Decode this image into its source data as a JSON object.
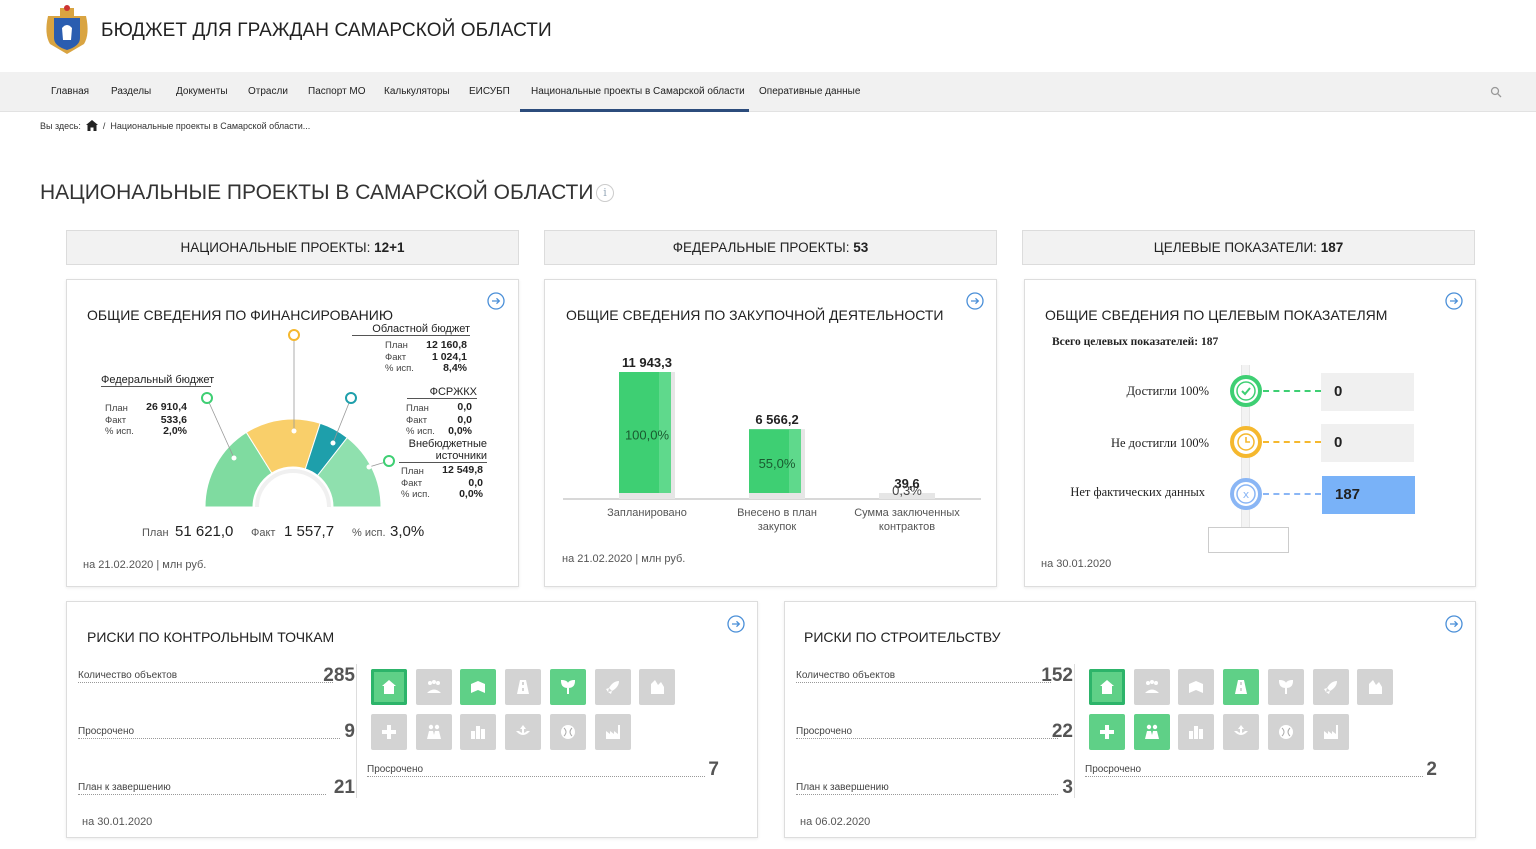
{
  "header": {
    "title": "БЮДЖЕТ ДЛЯ ГРАЖДАН САМАРСКОЙ ОБЛАСТИ"
  },
  "nav": {
    "items": [
      "Главная",
      "Разделы",
      "Документы",
      "Отрасли",
      "Паспорт МО",
      "Калькуляторы",
      "ЕИСУБП",
      "Национальные проекты в Самарской области",
      "Оперативные данные"
    ],
    "active": "Национальные проекты в Самарской области"
  },
  "breadcrumb": {
    "prefix": "Вы здесь:",
    "current": "Национальные проекты в Самарской области..."
  },
  "page": {
    "title": "НАЦИОНАЛЬНЫЕ ПРОЕКТЫ В САМАРСКОЙ ОБЛАСТИ",
    "info": "i"
  },
  "stats": [
    {
      "label": "НАЦИОНАЛЬНЫЕ ПРОЕКТЫ:",
      "value": "12+1"
    },
    {
      "label": "ФЕДЕРАЛЬНЫЕ ПРОЕКТЫ:",
      "value": "53"
    },
    {
      "label": "ЦЕЛЕВЫЕ ПОКАЗАТЕЛИ:",
      "value": "187"
    }
  ],
  "finance": {
    "title": "ОБЩИЕ СВЕДЕНИЯ ПО ФИНАНСИРОВАНИЮ",
    "federal": {
      "name": "Федеральный бюджет",
      "plan_l": "План",
      "plan": "26 910,4",
      "fact_l": "Факт",
      "fact": "533,6",
      "pct_l": "% исп.",
      "pct": "2,0%"
    },
    "regional": {
      "name": "Областной бюджет",
      "plan_l": "План",
      "plan": "12 160,8",
      "fact_l": "Факт",
      "fact": "1 024,1",
      "pct_l": "% исп.",
      "pct": "8,4%"
    },
    "fsr": {
      "name": "ФСРЖКХ",
      "plan_l": "План",
      "plan": "0,0",
      "fact_l": "Факт",
      "fact": "0,0",
      "pct_l": "% исп.",
      "pct": "0,0%"
    },
    "extra": {
      "name": "Внебюджетные источники",
      "plan_l": "План",
      "plan": "12 549,8",
      "fact_l": "Факт",
      "fact": "0,0",
      "pct_l": "% исп.",
      "pct": "0,0%"
    },
    "total": {
      "plan_l": "План",
      "plan": "51 621,0",
      "fact_l": "Факт",
      "fact": "1 557,7",
      "pct_l": "% исп.",
      "pct": "3,0%"
    },
    "footer": "на 21.02.2020 | млн руб.",
    "colors": {
      "federal": "#7fdba0",
      "regional": "#f9cf6a",
      "fsr": "#1e9fab",
      "extra": "#8fe0ae"
    }
  },
  "chart_data": {
    "type": "bar",
    "title": "ОБЩИЕ СВЕДЕНИЯ ПО ЗАКУПОЧНОЙ ДЕЯТЕЛЬНОСТИ",
    "categories": [
      "Запланировано",
      "Внесено в план закупок",
      "Сумма заключенных контрактов"
    ],
    "values": [
      11943.3,
      6566.2,
      39.6
    ],
    "value_labels": [
      "11 943,3",
      "6 566,2",
      "39,6"
    ],
    "pct_labels": [
      "100,0%",
      "55,0%",
      "0,3%"
    ],
    "ylim": [
      0,
      11943.3
    ],
    "color": "#3ecf73"
  },
  "procurement": {
    "footer": "на 21.02.2020 | млн руб."
  },
  "targets": {
    "title": "ОБЩИЕ СВЕДЕНИЯ ПО ЦЕЛЕВЫМ ПОКАЗАТЕЛЯМ",
    "total_label": "Всего целевых показателей: 187",
    "rows": [
      {
        "label": "Достигли 100%",
        "value": "0",
        "icon": "check-icon",
        "color": "#3ecf73"
      },
      {
        "label": "Не достигли 100%",
        "value": "0",
        "icon": "clock-icon",
        "color": "#f5b82e"
      },
      {
        "label": "Нет фактических данных",
        "value": "187",
        "icon": "x-icon",
        "color": "#8ab6f5"
      }
    ],
    "footer": "на 30.01.2020"
  },
  "risks_cp": {
    "title": "РИСКИ ПО КОНТРОЛЬНЫМ ТОЧКАМ",
    "count_l": "Количество объектов",
    "count": "285",
    "overdue_l": "Просрочено",
    "overdue": "9",
    "plan_l": "План к завершению",
    "plan": "21",
    "sel_overdue_l": "Просрочено",
    "sel_overdue": "7",
    "footer": "на 30.01.2020",
    "icons": [
      "home-icon",
      "people-icon",
      "education-icon",
      "road-icon",
      "ecology-icon",
      "rocket-icon",
      "culture-icon",
      "health-icon",
      "family-icon",
      "city-icon",
      "export-icon",
      "globe-icon",
      "industry-icon"
    ],
    "green": [
      0,
      2,
      4
    ]
  },
  "risks_build": {
    "title": "РИСКИ ПО СТРОИТЕЛЬСТВУ",
    "count_l": "Количество объектов",
    "count": "152",
    "overdue_l": "Просрочено",
    "overdue": "22",
    "plan_l": "План к завершению",
    "plan": "3",
    "sel_overdue_l": "Просрочено",
    "sel_overdue": "2",
    "footer": "на 06.02.2020",
    "icons": [
      "home-icon",
      "people-icon",
      "education-icon",
      "road-icon",
      "ecology-icon",
      "rocket-icon",
      "culture-icon",
      "health-icon",
      "family-icon",
      "city-icon",
      "export-icon",
      "globe-icon",
      "industry-icon"
    ],
    "green": [
      0,
      3,
      7,
      8
    ]
  }
}
